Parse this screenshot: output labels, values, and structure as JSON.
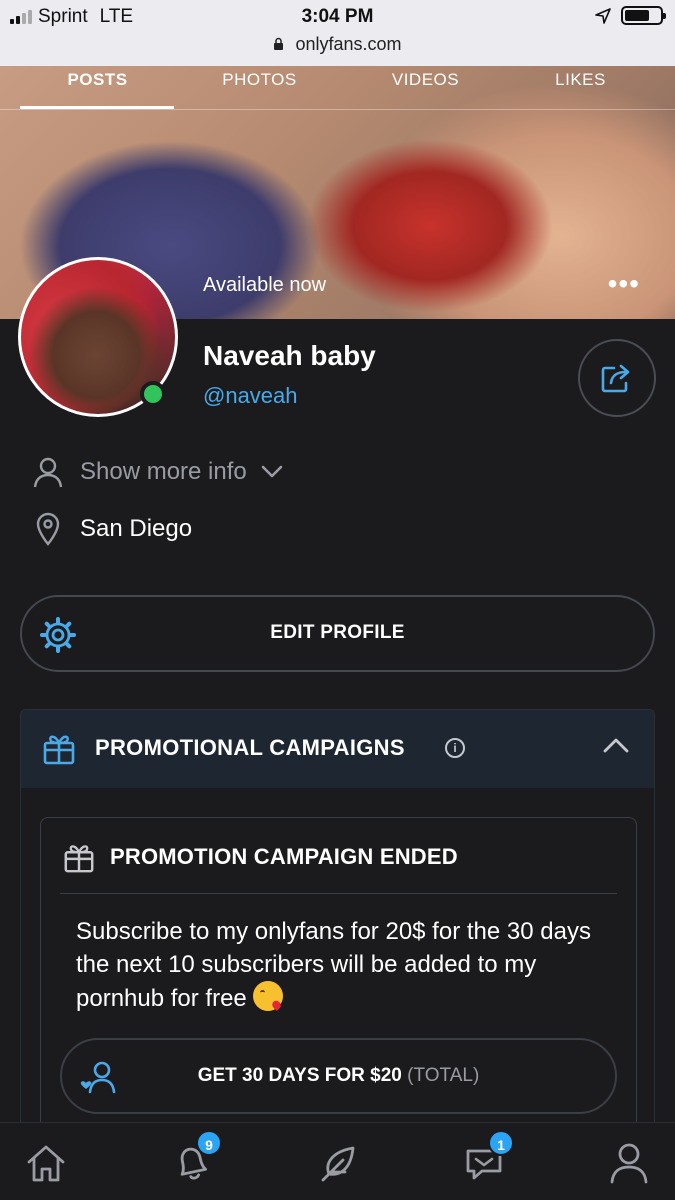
{
  "status_bar": {
    "carrier": "Sprint",
    "network": "LTE",
    "time": "3:04 PM",
    "url": "onlyfans.com"
  },
  "tabs": [
    {
      "label": "POSTS",
      "active": true
    },
    {
      "label": "PHOTOS",
      "active": false
    },
    {
      "label": "VIDEOS",
      "active": false
    },
    {
      "label": "LIKES",
      "active": false
    }
  ],
  "cover": {
    "availability": "Available now",
    "more_label": "•••"
  },
  "profile": {
    "name": "Naveah baby",
    "handle": "@naveah",
    "online": true,
    "show_more": "Show more info",
    "location": "San Diego"
  },
  "edit_profile": {
    "label": "EDIT PROFILE"
  },
  "promotional": {
    "title": "PROMOTIONAL CAMPAIGNS",
    "info_label": "i",
    "expanded": true,
    "campaign": {
      "title": "PROMOTION CAMPAIGN ENDED",
      "description": "Subscribe to my onlyfans for 20$ for the 30 days the next 10 subscribers will be added to my pornhub for free",
      "emoji": "face-blowing-a-kiss",
      "cta_label": "GET 30 DAYS FOR $20",
      "cta_sub": "(TOTAL)"
    }
  },
  "bottom_nav": {
    "notifications_badge": "9",
    "messages_badge": "1"
  },
  "colors": {
    "accent": "#4aa9e8",
    "background": "#1b1b1d",
    "online": "#32c45c",
    "badge": "#2aa4f4"
  }
}
